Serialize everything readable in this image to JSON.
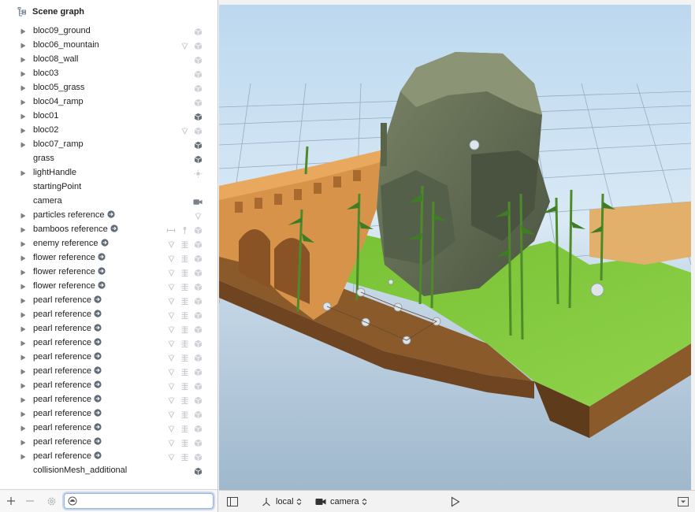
{
  "sidebar": {
    "title": "Scene graph",
    "title_icon": "scene-graph-icon",
    "items": [
      {
        "label": "bloc09_ground",
        "expandable": true,
        "ref": false,
        "icons": [
          "node-cube-icon"
        ]
      },
      {
        "label": "bloc06_mountain",
        "expandable": true,
        "ref": false,
        "icons": [
          "particle-icon",
          "node-cube-icon"
        ]
      },
      {
        "label": "bloc08_wall",
        "expandable": true,
        "ref": false,
        "icons": [
          "node-cube-icon"
        ]
      },
      {
        "label": "bloc03",
        "expandable": true,
        "ref": false,
        "icons": [
          "node-cube-icon"
        ]
      },
      {
        "label": "bloc05_grass",
        "expandable": true,
        "ref": false,
        "icons": [
          "node-cube-icon"
        ]
      },
      {
        "label": "bloc04_ramp",
        "expandable": true,
        "ref": false,
        "icons": [
          "node-cube-icon"
        ]
      },
      {
        "label": "bloc01",
        "expandable": true,
        "ref": false,
        "icons": [
          "geometry-cube-icon"
        ]
      },
      {
        "label": "bloc02",
        "expandable": true,
        "ref": false,
        "icons": [
          "particle-icon",
          "node-cube-icon"
        ]
      },
      {
        "label": "bloc07_ramp",
        "expandable": true,
        "ref": false,
        "icons": [
          "geometry-cube-icon"
        ]
      },
      {
        "label": "grass",
        "expandable": false,
        "ref": false,
        "icons": [
          "geometry-cube-icon"
        ]
      },
      {
        "label": "lightHandle",
        "expandable": true,
        "ref": false,
        "icons": [
          "light-icon"
        ]
      },
      {
        "label": "startingPoint",
        "expandable": false,
        "ref": false,
        "icons": []
      },
      {
        "label": "camera",
        "expandable": false,
        "ref": false,
        "icons": [
          "camera-icon"
        ]
      },
      {
        "label": "particles reference",
        "expandable": true,
        "ref": true,
        "icons": [
          "particle-icon"
        ]
      },
      {
        "label": "bamboos reference",
        "expandable": true,
        "ref": true,
        "icons": [
          "constraint-icon",
          "joint-icon",
          "node-cube-icon"
        ]
      },
      {
        "label": "enemy reference",
        "expandable": true,
        "ref": true,
        "icons": [
          "particle-icon",
          "physics-icon",
          "node-cube-icon"
        ]
      },
      {
        "label": "flower reference",
        "expandable": true,
        "ref": true,
        "icons": [
          "particle-icon",
          "physics-icon",
          "node-cube-icon"
        ]
      },
      {
        "label": "flower reference",
        "expandable": true,
        "ref": true,
        "icons": [
          "particle-icon",
          "physics-icon",
          "node-cube-icon"
        ]
      },
      {
        "label": "flower reference",
        "expandable": true,
        "ref": true,
        "icons": [
          "particle-icon",
          "physics-icon",
          "node-cube-icon"
        ]
      },
      {
        "label": "pearl reference",
        "expandable": true,
        "ref": true,
        "icons": [
          "particle-icon",
          "physics-icon",
          "node-cube-icon"
        ]
      },
      {
        "label": "pearl reference",
        "expandable": true,
        "ref": true,
        "icons": [
          "particle-icon",
          "physics-icon",
          "node-cube-icon"
        ]
      },
      {
        "label": "pearl reference",
        "expandable": true,
        "ref": true,
        "icons": [
          "particle-icon",
          "physics-icon",
          "node-cube-icon"
        ]
      },
      {
        "label": "pearl reference",
        "expandable": true,
        "ref": true,
        "icons": [
          "particle-icon",
          "physics-icon",
          "node-cube-icon"
        ]
      },
      {
        "label": "pearl reference",
        "expandable": true,
        "ref": true,
        "icons": [
          "particle-icon",
          "physics-icon",
          "node-cube-icon"
        ]
      },
      {
        "label": "pearl reference",
        "expandable": true,
        "ref": true,
        "icons": [
          "particle-icon",
          "physics-icon",
          "node-cube-icon"
        ]
      },
      {
        "label": "pearl reference",
        "expandable": true,
        "ref": true,
        "icons": [
          "particle-icon",
          "physics-icon",
          "node-cube-icon"
        ]
      },
      {
        "label": "pearl reference",
        "expandable": true,
        "ref": true,
        "icons": [
          "particle-icon",
          "physics-icon",
          "node-cube-icon"
        ]
      },
      {
        "label": "pearl reference",
        "expandable": true,
        "ref": true,
        "icons": [
          "particle-icon",
          "physics-icon",
          "node-cube-icon"
        ]
      },
      {
        "label": "pearl reference",
        "expandable": true,
        "ref": true,
        "icons": [
          "particle-icon",
          "physics-icon",
          "node-cube-icon"
        ]
      },
      {
        "label": "pearl reference",
        "expandable": true,
        "ref": true,
        "icons": [
          "particle-icon",
          "physics-icon",
          "node-cube-icon"
        ]
      },
      {
        "label": "pearl reference",
        "expandable": true,
        "ref": true,
        "icons": [
          "particle-icon",
          "physics-icon",
          "node-cube-icon"
        ]
      },
      {
        "label": "collisionMesh_additional",
        "expandable": false,
        "ref": false,
        "icons": [
          "geometry-cube-icon"
        ]
      }
    ],
    "footer": {
      "add_icon": "plus-icon",
      "remove_icon": "minus-icon",
      "settings_icon": "gear-icon",
      "filter_icon": "filter-icon",
      "filter_value": "",
      "filter_placeholder": ""
    }
  },
  "bottombar": {
    "toggle_icon": "sidebar-toggle-icon",
    "space": {
      "label": "local",
      "icon": "coordinate-axes-icon"
    },
    "pov": {
      "label": "camera",
      "icon": "video-camera-icon"
    },
    "play_icon": "play-icon",
    "menu_icon": "dropdown-menu-icon"
  },
  "viewport": {
    "description_icon": "scene-render",
    "colors": {
      "sky_top": "#c9dff1",
      "sky_bottom": "#e6f0f7",
      "grid": "#8aa0b8",
      "water": "#a7bfd3",
      "grass": "#7ec63a",
      "dirt": "#8a5a2b",
      "wall": "#d8934a",
      "rock": "#5f6850"
    }
  }
}
